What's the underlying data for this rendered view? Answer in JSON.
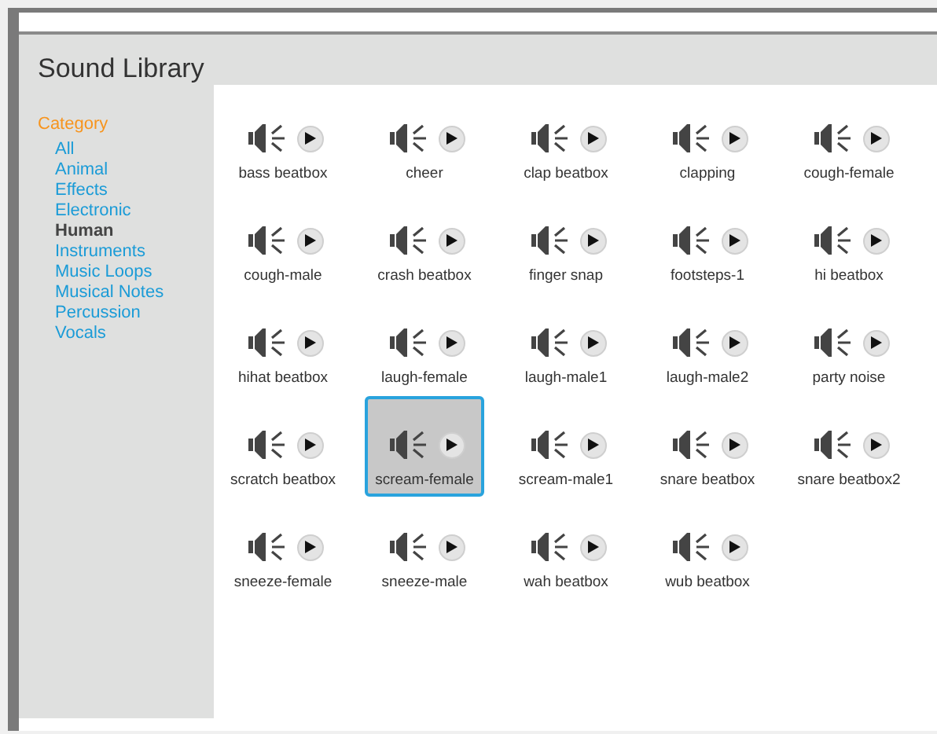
{
  "title": "Sound Library",
  "sidebar": {
    "heading": "Category",
    "items": [
      {
        "label": "All",
        "selected": false
      },
      {
        "label": "Animal",
        "selected": false
      },
      {
        "label": "Effects",
        "selected": false
      },
      {
        "label": "Electronic",
        "selected": false
      },
      {
        "label": "Human",
        "selected": true
      },
      {
        "label": "Instruments",
        "selected": false
      },
      {
        "label": "Music Loops",
        "selected": false
      },
      {
        "label": "Musical Notes",
        "selected": false
      },
      {
        "label": "Percussion",
        "selected": false
      },
      {
        "label": "Vocals",
        "selected": false
      }
    ]
  },
  "sounds": [
    {
      "name": "bass beatbox",
      "selected": false
    },
    {
      "name": "cheer",
      "selected": false
    },
    {
      "name": "clap beatbox",
      "selected": false
    },
    {
      "name": "clapping",
      "selected": false
    },
    {
      "name": "cough-female",
      "selected": false
    },
    {
      "name": "cough-male",
      "selected": false
    },
    {
      "name": "crash beatbox",
      "selected": false
    },
    {
      "name": "finger snap",
      "selected": false
    },
    {
      "name": "footsteps-1",
      "selected": false
    },
    {
      "name": "hi beatbox",
      "selected": false
    },
    {
      "name": "hihat beatbox",
      "selected": false
    },
    {
      "name": "laugh-female",
      "selected": false
    },
    {
      "name": "laugh-male1",
      "selected": false
    },
    {
      "name": "laugh-male2",
      "selected": false
    },
    {
      "name": "party noise",
      "selected": false
    },
    {
      "name": "scratch beatbox",
      "selected": false
    },
    {
      "name": "scream-female",
      "selected": true
    },
    {
      "name": "scream-male1",
      "selected": false
    },
    {
      "name": "snare beatbox",
      "selected": false
    },
    {
      "name": "snare beatbox2",
      "selected": false
    },
    {
      "name": "sneeze-female",
      "selected": false
    },
    {
      "name": "sneeze-male",
      "selected": false
    },
    {
      "name": "wah beatbox",
      "selected": false
    },
    {
      "name": "wub beatbox",
      "selected": false
    }
  ]
}
